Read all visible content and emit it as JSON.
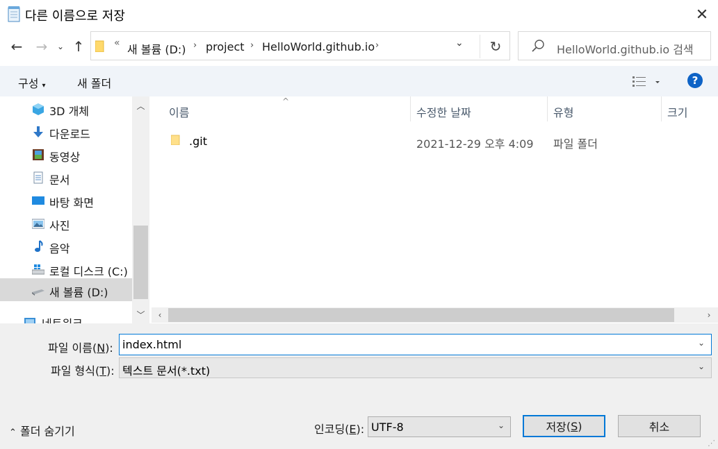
{
  "window": {
    "title": "다른 이름으로 저장"
  },
  "address": {
    "overflow": "«",
    "crumbs": [
      "새 볼륨 (D:)",
      "project",
      "HelloWorld.github.io"
    ]
  },
  "search": {
    "placeholder": "HelloWorld.github.io 검색"
  },
  "toolbar": {
    "organize": "구성",
    "new_folder": "새 폴더",
    "help": "?"
  },
  "nav": {
    "items": [
      {
        "label": "3D 개체",
        "icon": "3d-objects-icon"
      },
      {
        "label": "다운로드",
        "icon": "download-icon"
      },
      {
        "label": "동영상",
        "icon": "video-icon"
      },
      {
        "label": "문서",
        "icon": "document-icon"
      },
      {
        "label": "바탕 화면",
        "icon": "desktop-icon"
      },
      {
        "label": "사진",
        "icon": "pictures-icon"
      },
      {
        "label": "음악",
        "icon": "music-icon"
      },
      {
        "label": "로컬 디스크 (C:)",
        "icon": "drive-icon"
      },
      {
        "label": "새 볼륨 (D:)",
        "icon": "drive-icon",
        "selected": true
      },
      {
        "label": "네트워크",
        "icon": "network-icon"
      }
    ]
  },
  "columns": {
    "name": "이름",
    "modified": "수정한 날짜",
    "type": "유형",
    "size": "크기"
  },
  "files": [
    {
      "name": ".git",
      "modified": "2021-12-29 오후 4:09",
      "type": "파일 폴더"
    }
  ],
  "form": {
    "filename_label": "파일 이름",
    "filename_key": "N",
    "filename_value": "index.html",
    "filetype_label": "파일 형식",
    "filetype_key": "T",
    "filetype_value": "텍스트 문서(*.txt)",
    "encoding_label": "인코딩",
    "encoding_key": "E",
    "encoding_value": "UTF-8"
  },
  "buttons": {
    "hide_folders": "폴더 숨기기",
    "save": "저장",
    "save_key": "S",
    "cancel": "취소"
  }
}
